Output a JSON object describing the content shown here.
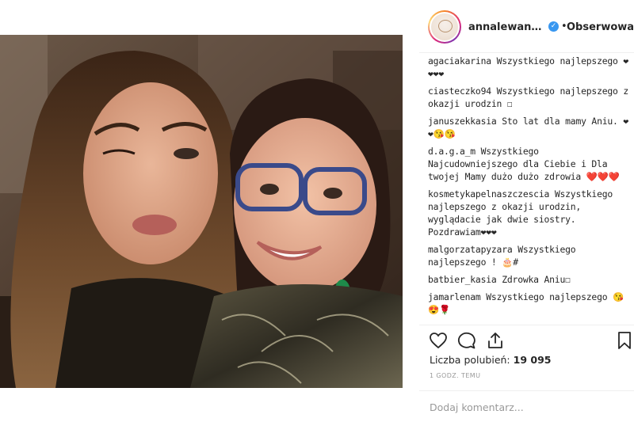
{
  "post": {
    "username": "annalewando...",
    "verified_mark": "✓",
    "separator": "•",
    "follow_label": "Obserwowanie",
    "likes_label": "Liczba polubień:",
    "likes_count": "19 095",
    "time_label": "1 GODZ. TEMU",
    "add_comment_placeholder": "Dodaj komentarz..."
  },
  "comments": [
    {
      "user": "agaciakarina",
      "text": "Wszystkiego najlepszego ❤❤❤❤"
    },
    {
      "user": "ciasteczko94",
      "text": "Wszystkiego najlepszego z okazji urodzin ☐"
    },
    {
      "user": "januszekkasia",
      "text": "Sto lat dla mamy Aniu. ❤❤😘😘"
    },
    {
      "user": "d.a.g.a_m",
      "text": "Wszystkiego Najcudowniejszego dla Ciebie i Dla twojej Mamy dużo dużo zdrowia ❤️❤️❤️"
    },
    {
      "user": "kosmetykapelnaszczescia",
      "text": "Wszystkiego najlepszego z okazji urodzin, wyglądacie jak dwie siostry. Pozdrawiam❤❤❤"
    },
    {
      "user": "malgorzatapyzara",
      "text": "Wszystkiego najlepszego ! 🎂#"
    },
    {
      "user": "batbier_kasia",
      "text": "Zdrowka Aniu☐"
    },
    {
      "user": "jamarlenam",
      "text": "Wszystkiego najlepszego 😘😍🌹"
    }
  ],
  "icons": {
    "like": "heart-icon",
    "comment": "comment-bubble-icon",
    "share": "share-icon",
    "save": "bookmark-icon"
  },
  "colors": {
    "verified": "#3897f0",
    "border": "#efefef",
    "muted": "#999999",
    "text": "#262626"
  }
}
